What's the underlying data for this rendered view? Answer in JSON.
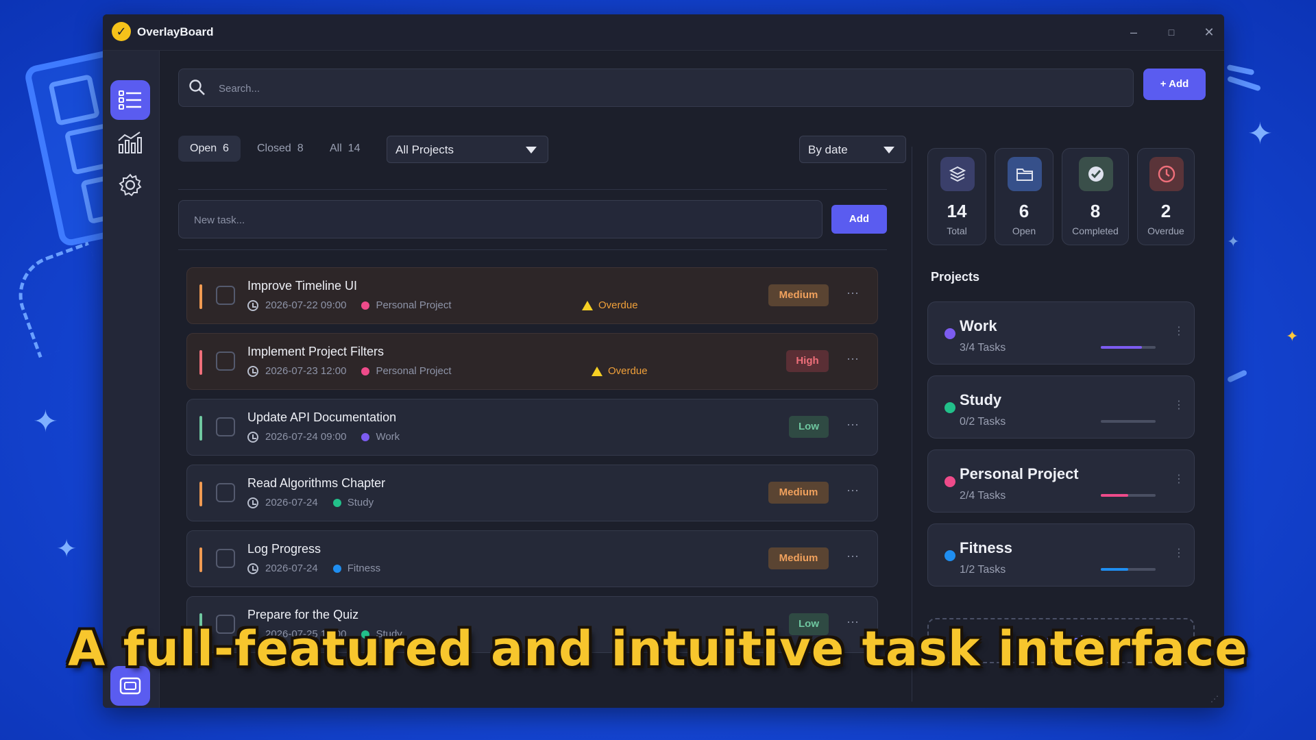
{
  "app": {
    "title": "OverlayBoard"
  },
  "window_controls": {
    "minimize": "–",
    "maximize": "□",
    "close": "✕"
  },
  "sidebar": {
    "items": [
      {
        "name": "tasks",
        "icon": "list-icon",
        "active": true
      },
      {
        "name": "analytics",
        "icon": "chart-icon",
        "active": false
      },
      {
        "name": "settings",
        "icon": "gear-icon",
        "active": false
      }
    ]
  },
  "search": {
    "placeholder": "Search...",
    "value": ""
  },
  "toolbar": {
    "add_label": "+ Add"
  },
  "filters": {
    "tabs": [
      {
        "label": "Open",
        "count": "6",
        "active": true
      },
      {
        "label": "Closed",
        "count": "8",
        "active": false
      },
      {
        "label": "All",
        "count": "14",
        "active": false
      }
    ],
    "project_select": "All Projects",
    "sort_select": "By date"
  },
  "new_task": {
    "placeholder": "New task...",
    "add_label": "Add"
  },
  "tasks": [
    {
      "title": "Improve Timeline UI",
      "date": "2026-07-22",
      "time": "09:00",
      "project": "Personal Project",
      "overdue": "Overdue",
      "priority": "Medium"
    },
    {
      "title": "Implement Project Filters",
      "date": "2026-07-23",
      "time": "12:00",
      "project": "Personal Project",
      "overdue": "Overdue",
      "priority": "High"
    },
    {
      "title": "Update API Documentation",
      "date": "2026-07-24",
      "time": "09:00",
      "project": "Work",
      "overdue": "",
      "priority": "Low"
    },
    {
      "title": "Read Algorithms Chapter",
      "date": "2026-07-24",
      "time": "",
      "project": "Study",
      "overdue": "",
      "priority": "Medium"
    },
    {
      "title": "Log Progress",
      "date": "2026-07-24",
      "time": "",
      "project": "Fitness",
      "overdue": "",
      "priority": "Medium"
    },
    {
      "title": "Prepare for the Quiz",
      "date": "2026-07-25",
      "time": "12:00",
      "project": "Study",
      "overdue": "",
      "priority": "Low"
    }
  ],
  "stats": [
    {
      "value": "14",
      "label": "Total",
      "icon": "layers-icon"
    },
    {
      "value": "6",
      "label": "Open",
      "icon": "folder-icon"
    },
    {
      "value": "8",
      "label": "Completed",
      "icon": "check-icon"
    },
    {
      "value": "2",
      "label": "Overdue",
      "icon": "clock-icon"
    }
  ],
  "projects_title": "Projects",
  "projects": [
    {
      "name": "Work",
      "tasks": "3/4 Tasks",
      "progress": 0.75,
      "color": "#7c5cf0"
    },
    {
      "name": "Study",
      "tasks": "0/2 Tasks",
      "progress": 0,
      "color": "#22c08a"
    },
    {
      "name": "Personal Project",
      "tasks": "2/4 Tasks",
      "progress": 0.5,
      "color": "#ee4b8a"
    },
    {
      "name": "Fitness",
      "tasks": "1/2 Tasks",
      "progress": 0.5,
      "color": "#1f8ef0"
    }
  ],
  "new_project_label": "+ New project",
  "caption": "A full-featured and intuitive task interface",
  "colors": {
    "accent": "#5a5cf0",
    "project_work": "#7c5cf0",
    "project_study": "#22c08a",
    "project_personal": "#ee4b8a",
    "project_fitness": "#1f8ef0",
    "priority_medium": "#f0a15d",
    "priority_high": "#ef6f7a",
    "priority_low": "#6fc7a0",
    "overdue": "#f0a03a"
  }
}
